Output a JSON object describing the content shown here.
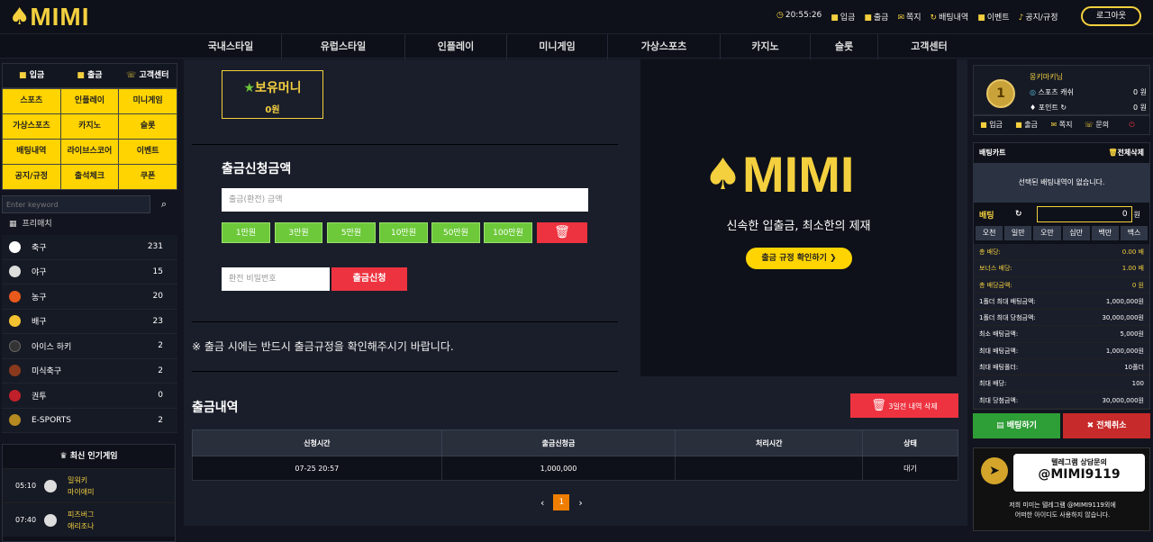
{
  "header": {
    "logo": "MIMI",
    "clock": "20:55:26",
    "menu": [
      {
        "icon": "■",
        "label": "입금"
      },
      {
        "icon": "■",
        "label": "출금"
      },
      {
        "icon": "✉",
        "label": "쪽지"
      },
      {
        "icon": "↻",
        "label": "배팅내역"
      },
      {
        "icon": "■",
        "label": "이벤트"
      },
      {
        "icon": "♪",
        "label": "공지/규정"
      }
    ],
    "logout": "로그아웃"
  },
  "nav": [
    "국내스타일",
    "유럽스타일",
    "인플레이",
    "미니게임",
    "가상스포츠",
    "카지노",
    "슬롯",
    "고객센터"
  ],
  "left": {
    "quick": [
      "입금",
      "출금",
      "고객센터"
    ],
    "grid": [
      "스포츠",
      "인플레이",
      "미니게임",
      "가상스포츠",
      "카지노",
      "슬롯",
      "배팅내역",
      "라이브스코어",
      "이벤트",
      "공지/규정",
      "출석체크",
      "쿠폰"
    ],
    "search_placeholder": "Enter keyword",
    "prematch": "프리매치",
    "sports": [
      {
        "name": "축구",
        "count": "231",
        "color": "#ffffff"
      },
      {
        "name": "야구",
        "count": "15",
        "color": "#dddddd"
      },
      {
        "name": "농구",
        "count": "20",
        "color": "#e8591c"
      },
      {
        "name": "배구",
        "count": "23",
        "color": "#f2c230"
      },
      {
        "name": "아이스 하키",
        "count": "2",
        "color": "#333333"
      },
      {
        "name": "미식축구",
        "count": "2",
        "color": "#8a3a1c"
      },
      {
        "name": "권투",
        "count": "0",
        "color": "#c0202a"
      },
      {
        "name": "E-SPORTS",
        "count": "2",
        "color": "#b58a20"
      }
    ],
    "popular_title": "최신 인기게임",
    "games": [
      {
        "time": "05:10",
        "home": "밀워키",
        "away": "마이애미"
      },
      {
        "time": "07:40",
        "home": "피츠버그",
        "away": "애리조나"
      }
    ]
  },
  "main": {
    "balance_label": "보유머니",
    "balance": "0원",
    "withdraw_title": "출금신청금액",
    "amount_placeholder": "출금(환전) 금액",
    "amounts": [
      "1만원",
      "3만원",
      "5만원",
      "10만원",
      "50만원",
      "100만원"
    ],
    "pw_placeholder": "환전 비밀번호",
    "apply": "출금신청",
    "notice": "※ 출금 시에는 반드시 출금규정을 확인해주시기 바랍니다.",
    "history_title": "출금내역",
    "delete_old": "3일전 내역 삭제",
    "columns": [
      "신청시간",
      "출금신청금",
      "처리시간",
      "상태"
    ],
    "rows": [
      [
        "07-25 20:57",
        "1,000,000",
        "",
        "대기"
      ]
    ],
    "page": "1"
  },
  "promo": {
    "logo": "MIMI",
    "tagline": "신속한 입출금, 최소한의 제재",
    "button": "출금 규정 확인하기"
  },
  "right": {
    "user": "몽키마키님",
    "sports_cash_label": "스포츠 캐쉬",
    "sports_cash": "0 원",
    "point_label": "포인트",
    "point": "0 원",
    "buttons": [
      "입금",
      "출금",
      "쪽지",
      "문의"
    ],
    "cart_title": "배팅카트",
    "clear_all": "전체삭제",
    "cart_empty": "선택된 배팅내역이 없습니다.",
    "stake_label": "배팅",
    "stake": "0",
    "stake_unit": "원",
    "chips": [
      "오천",
      "일만",
      "오만",
      "십만",
      "백만",
      "맥스"
    ],
    "info": [
      [
        "총 배당:",
        "0.00 배"
      ],
      [
        "보너스 배당:",
        "1.00 배"
      ],
      [
        "총 배당금액:",
        "0 원"
      ],
      [
        "1폴더 최대 배팅금액:",
        "1,000,000원"
      ],
      [
        "1폴더 최대 당첨금액:",
        "30,000,000원"
      ],
      [
        "최소 배팅금액:",
        "5,000원"
      ],
      [
        "최대 배팅금액:",
        "1,000,000원"
      ],
      [
        "최대 배팅폴더:",
        "10폴더"
      ],
      [
        "최대 배당:",
        "100"
      ],
      [
        "최대 당첨금액:",
        "30,000,000원"
      ]
    ],
    "bet": "배팅하기",
    "cancel_all": "전체취소",
    "tg_line1": "텔레그램 상담문의",
    "tg_id": "@MIMI9119",
    "tg_note1": "저희 미미는 텔레그램 @MIMI9119외에",
    "tg_note2": "어떠한 아이디도 사용하지 않습니다."
  }
}
